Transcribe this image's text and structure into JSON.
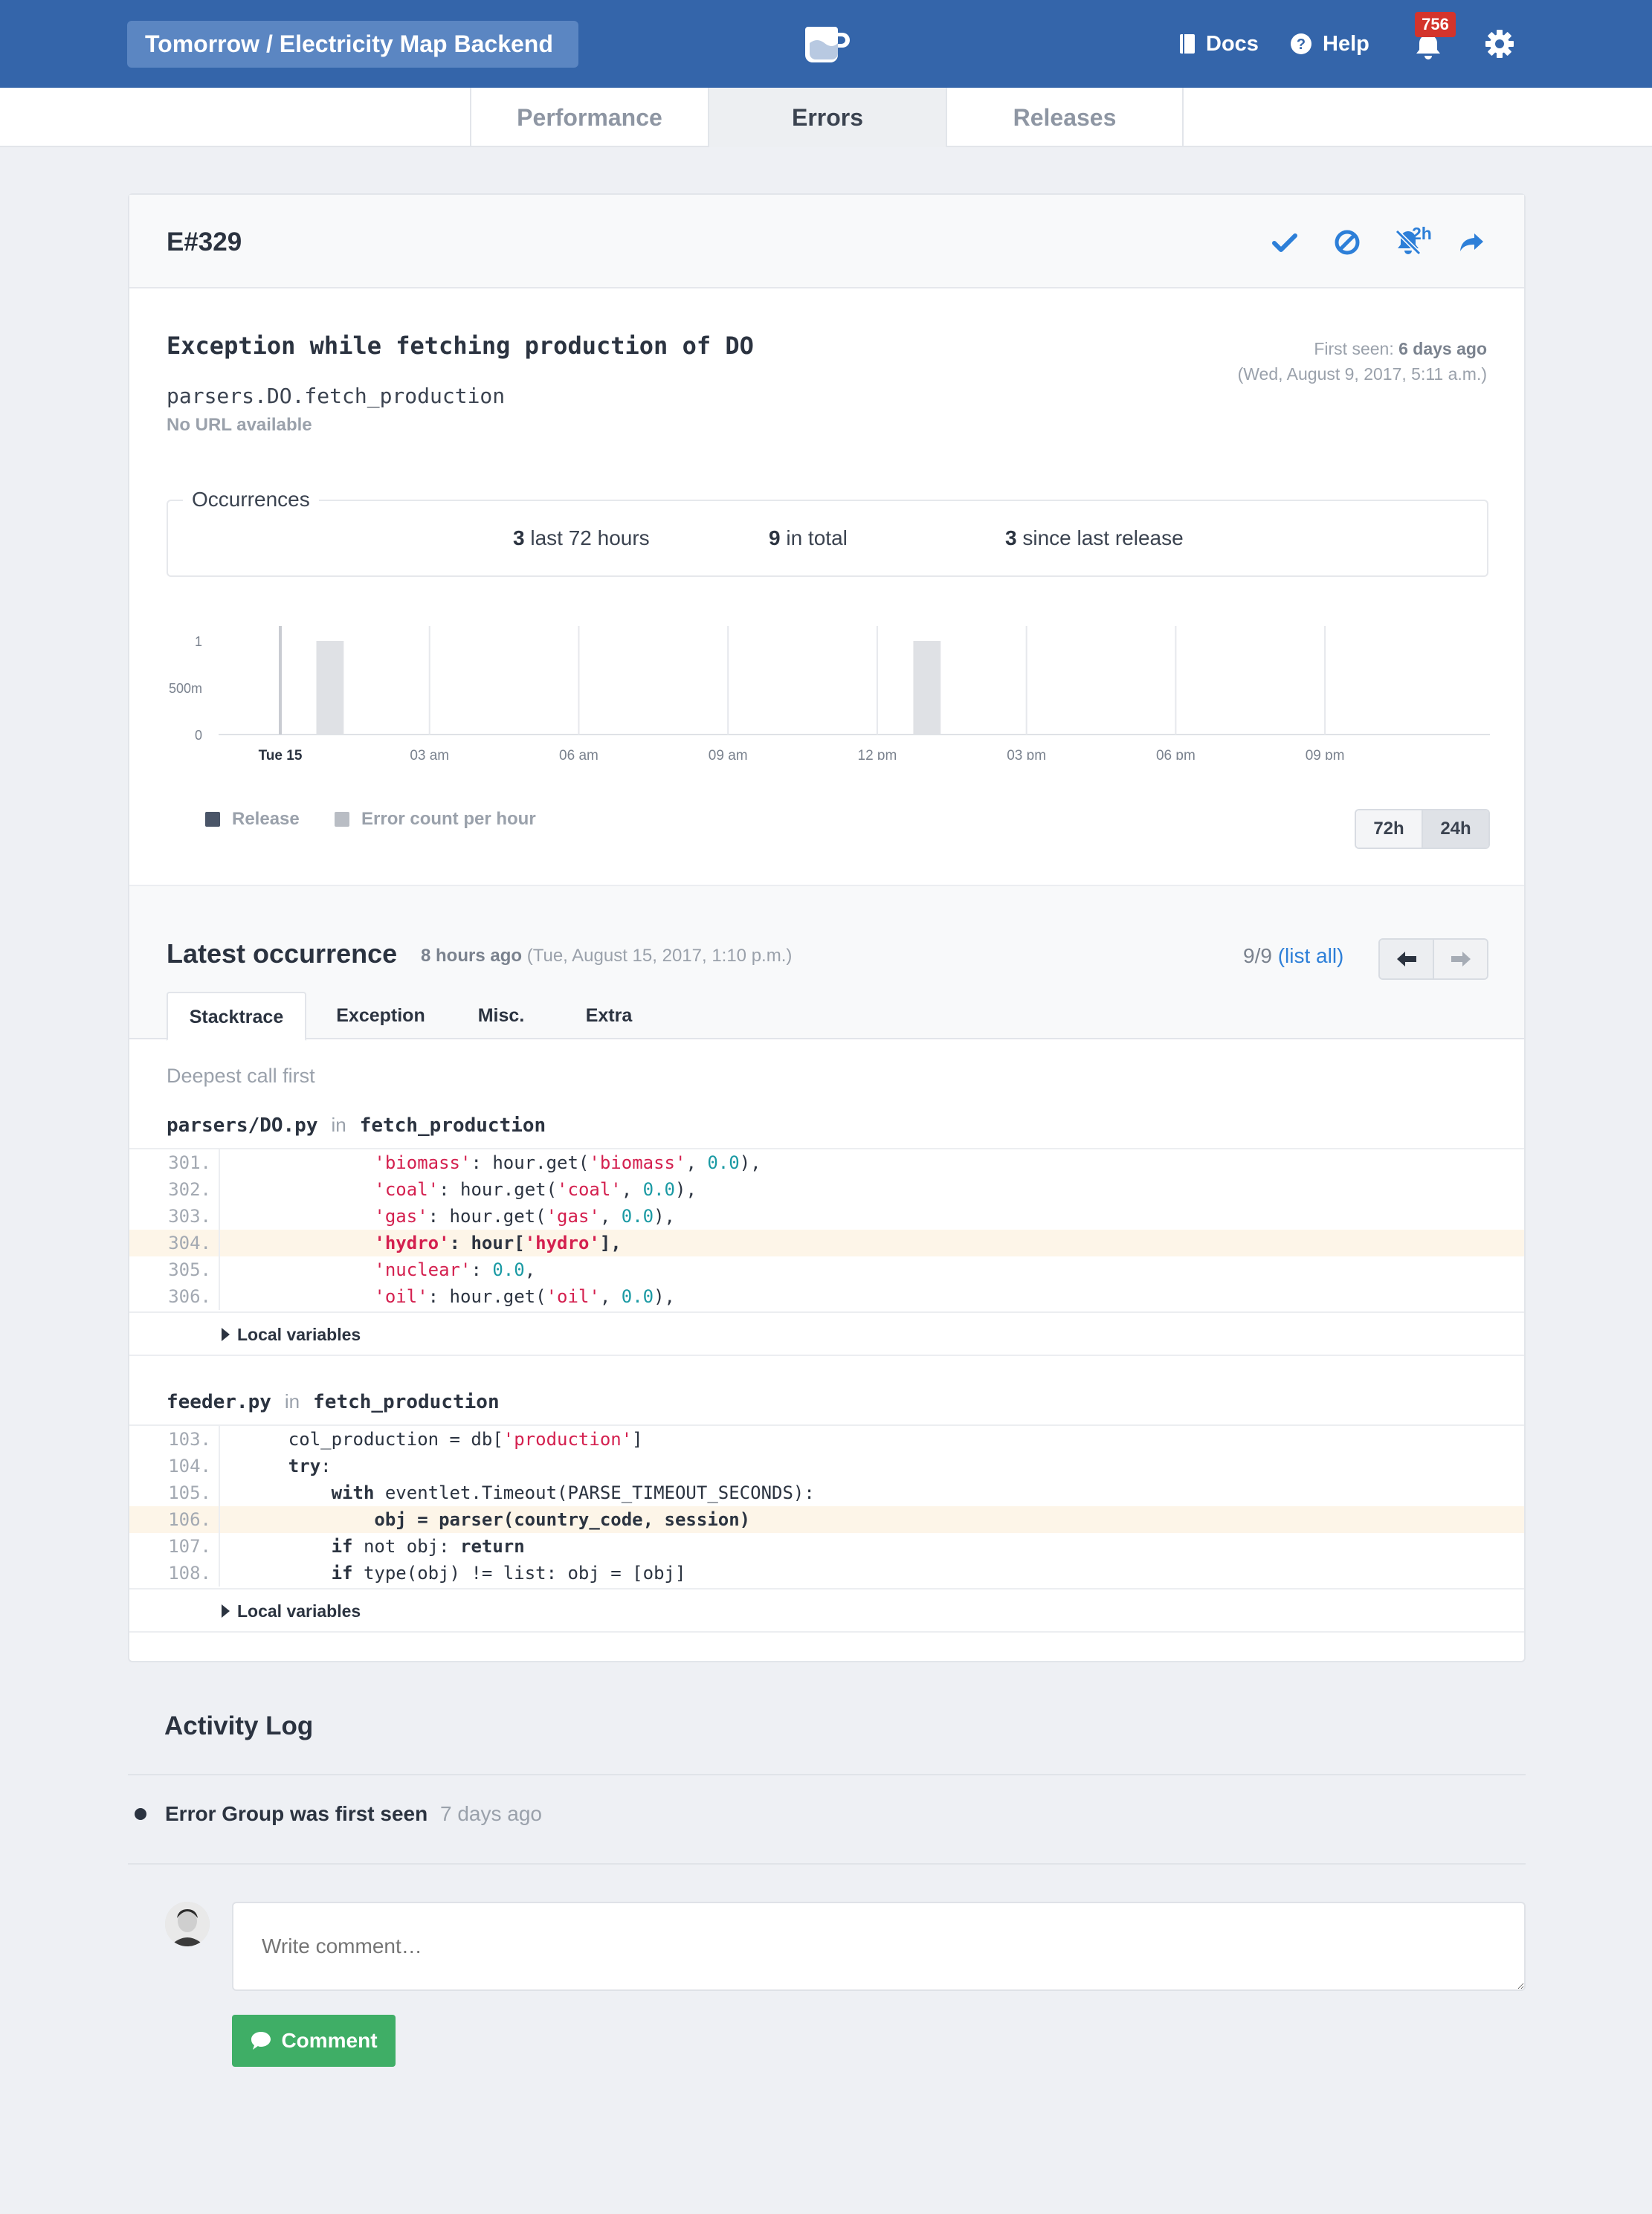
{
  "header": {
    "project": "Tomorrow / Electricity Map Backend",
    "docs": "Docs",
    "help": "Help",
    "notifications": "756"
  },
  "tabs": [
    "Performance",
    "Errors",
    "Releases"
  ],
  "active_tab": "Errors",
  "error": {
    "id": "E#329",
    "snooze_label": "2h",
    "title": "Exception while fetching production of DO",
    "func": "parsers.DO.fetch_production",
    "url": "No URL available",
    "first_seen_prefix": "First seen:",
    "first_seen_ago": "6 days ago",
    "first_seen_date": "(Wed, August 9, 2017, 5:11 a.m.)"
  },
  "occurrences": {
    "label": "Occurrences",
    "last72_count": "3",
    "last72_label": "last 72 hours",
    "total_count": "9",
    "total_label": "in total",
    "release_count": "3",
    "release_label": "since last release"
  },
  "chart_data": {
    "type": "bar",
    "y_ticks": [
      "1",
      "500m",
      "0"
    ],
    "x_ticks": [
      "Tue 15",
      "03 am",
      "06 am",
      "09 am",
      "12 pm",
      "03 pm",
      "06 pm",
      "09 pm"
    ],
    "ylim": [
      0,
      1
    ],
    "series": [
      {
        "name": "Error count per hour",
        "bars": [
          {
            "hour": 1,
            "value": 1
          },
          {
            "hour": 13,
            "value": 1
          }
        ]
      },
      {
        "name": "Release",
        "markers": [
          {
            "hour": 0
          }
        ]
      }
    ],
    "legend": [
      "Release",
      "Error count per hour"
    ],
    "colors": {
      "release": "#4a5568",
      "errors": "#dfe1e5"
    }
  },
  "range": {
    "options": [
      "72h",
      "24h"
    ],
    "selected": "24h"
  },
  "latest": {
    "title": "Latest occurrence",
    "ago": "8 hours ago",
    "date": "(Tue, August 15, 2017, 1:10 p.m.)",
    "count": "9/9",
    "list_all": "(list all)"
  },
  "subtabs": [
    "Stacktrace",
    "Exception",
    "Misc.",
    "Extra"
  ],
  "stacktrace": {
    "heading": "Deepest call first",
    "in": "in",
    "locals_label": "Local variables",
    "frames": [
      {
        "file": "parsers/DO.py",
        "func": "fetch_production",
        "lines": [
          {
            "no": "301.",
            "indent": "            ",
            "tokens": [
              [
                "str",
                "'biomass'"
              ],
              [
                "plain",
                ": hour.get("
              ],
              [
                "str",
                "'biomass'"
              ],
              [
                "plain",
                ", "
              ],
              [
                "num",
                "0.0"
              ],
              [
                "plain",
                "),"
              ]
            ]
          },
          {
            "no": "302.",
            "indent": "            ",
            "tokens": [
              [
                "str",
                "'coal'"
              ],
              [
                "plain",
                ": hour.get("
              ],
              [
                "str",
                "'coal'"
              ],
              [
                "plain",
                ", "
              ],
              [
                "num",
                "0.0"
              ],
              [
                "plain",
                "),"
              ]
            ]
          },
          {
            "no": "303.",
            "indent": "            ",
            "tokens": [
              [
                "str",
                "'gas'"
              ],
              [
                "plain",
                ": hour.get("
              ],
              [
                "str",
                "'gas'"
              ],
              [
                "plain",
                ", "
              ],
              [
                "num",
                "0.0"
              ],
              [
                "plain",
                "),"
              ]
            ]
          },
          {
            "no": "304.",
            "indent": "            ",
            "hl": true,
            "tokens": [
              [
                "str",
                "'hydro'"
              ],
              [
                "plain",
                ": hour["
              ],
              [
                "str",
                "'hydro'"
              ],
              [
                "plain",
                "],"
              ]
            ]
          },
          {
            "no": "305.",
            "indent": "            ",
            "tokens": [
              [
                "str",
                "'nuclear'"
              ],
              [
                "plain",
                ": "
              ],
              [
                "num",
                "0.0"
              ],
              [
                "plain",
                ","
              ]
            ]
          },
          {
            "no": "306.",
            "indent": "            ",
            "tokens": [
              [
                "str",
                "'oil'"
              ],
              [
                "plain",
                ": hour.get("
              ],
              [
                "str",
                "'oil'"
              ],
              [
                "plain",
                ", "
              ],
              [
                "num",
                "0.0"
              ],
              [
                "plain",
                "),"
              ]
            ]
          }
        ]
      },
      {
        "file": "feeder.py",
        "func": "fetch_production",
        "lines": [
          {
            "no": "103.",
            "indent": "    ",
            "tokens": [
              [
                "plain",
                "col_production = db["
              ],
              [
                "str",
                "'production'"
              ],
              [
                "plain",
                "]"
              ]
            ]
          },
          {
            "no": "104.",
            "indent": "    ",
            "tokens": [
              [
                "kw",
                "try"
              ],
              [
                "plain",
                ":"
              ]
            ]
          },
          {
            "no": "105.",
            "indent": "        ",
            "tokens": [
              [
                "kw",
                "with"
              ],
              [
                "plain",
                " eventlet.Timeout(PARSE_TIMEOUT_SECONDS):"
              ]
            ]
          },
          {
            "no": "106.",
            "indent": "            ",
            "hl": true,
            "tokens": [
              [
                "plain",
                "obj = parser(country_code, session)"
              ]
            ]
          },
          {
            "no": "107.",
            "indent": "        ",
            "tokens": [
              [
                "kw",
                "if"
              ],
              [
                "plain",
                " not obj: "
              ],
              [
                "kw",
                "return"
              ]
            ]
          },
          {
            "no": "108.",
            "indent": "        ",
            "tokens": [
              [
                "kw",
                "if"
              ],
              [
                "plain",
                " type(obj) != list: obj = [obj]"
              ]
            ]
          }
        ]
      }
    ]
  },
  "activity": {
    "title": "Activity Log",
    "event": "Error Group was first seen",
    "event_time": "7 days ago"
  },
  "comment": {
    "placeholder": "Write comment…",
    "button": "Comment"
  }
}
